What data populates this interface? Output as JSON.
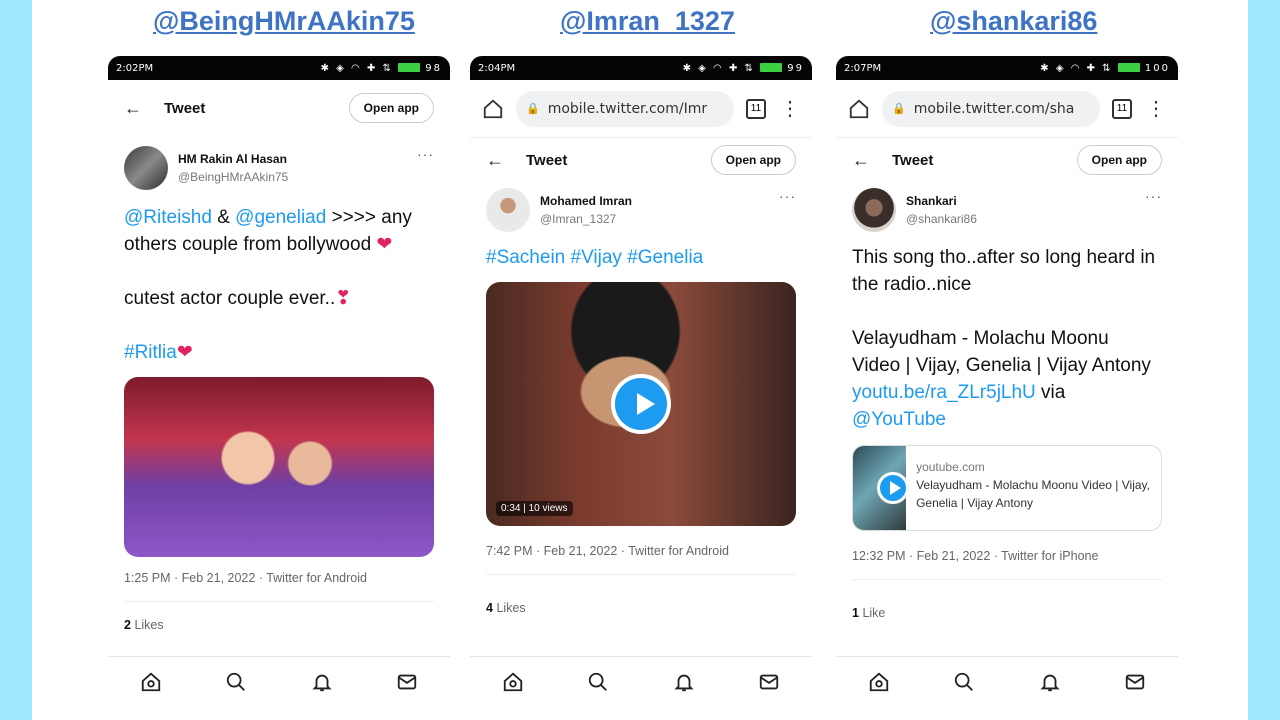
{
  "panels": [
    {
      "account_handle": "@BeingHMrAAkin75",
      "status_time": "2:02PM",
      "status_battery": "98",
      "tweet_title": "Tweet",
      "open_app": "Open app",
      "author_name": "HM Rakin Al Hasan",
      "author_handle": "@BeingHMrAAkin75",
      "mention1": "@Riteishd",
      "amp": " & ",
      "mention2": "@geneliad",
      "line1_rest": " >>>> any others couple from bollywood ",
      "line2": "cutest actor couple ever..",
      "hashtag": "#Ritlia",
      "timestamp": "1:25 PM · Feb 21, 2022 · Twitter for Android",
      "likes_count": "2",
      "likes_label": "Likes"
    },
    {
      "account_handle": "@Imran_1327",
      "status_time": "2:04PM",
      "status_battery": "99",
      "url": "mobile.twitter.com/Imr",
      "tab_count": "11",
      "tweet_title": "Tweet",
      "open_app": "Open app",
      "author_name": "Mohamed Imran",
      "author_handle": "@Imran_1327",
      "hashtags": "#Sachein #Vijay #Genelia",
      "video_badge": "0:34 | 10 views",
      "timestamp": "7:42 PM · Feb 21, 2022 · Twitter for Android",
      "likes_count": "4",
      "likes_label": "Likes"
    },
    {
      "account_handle": "@shankari86",
      "status_time": "2:07PM",
      "status_battery": "100",
      "url": "mobile.twitter.com/sha",
      "tab_count": "11",
      "tweet_title": "Tweet",
      "open_app": "Open app",
      "author_name": "Shankari",
      "author_handle": "@shankari86",
      "line1": "This song tho..after so long heard in the radio..nice",
      "line2": "Velayudham - Molachu Moonu Video | Vijay, Genelia | Vijay Antony ",
      "link": "youtu.be/ra_ZLr5jLhU",
      "via": " via",
      "youtube": "@YouTube",
      "card_domain": "youtube.com",
      "card_title": "Velayudham - Molachu Moonu Video | Vijay, Genelia | Vijay Antony",
      "timestamp": "12:32 PM · Feb 21, 2022 · Twitter for iPhone",
      "likes_count": "1",
      "likes_label": "Like"
    }
  ],
  "colors": {
    "link": "#1d9bf0",
    "heading": "#3f74c5",
    "bg": "#9fe8fb"
  }
}
